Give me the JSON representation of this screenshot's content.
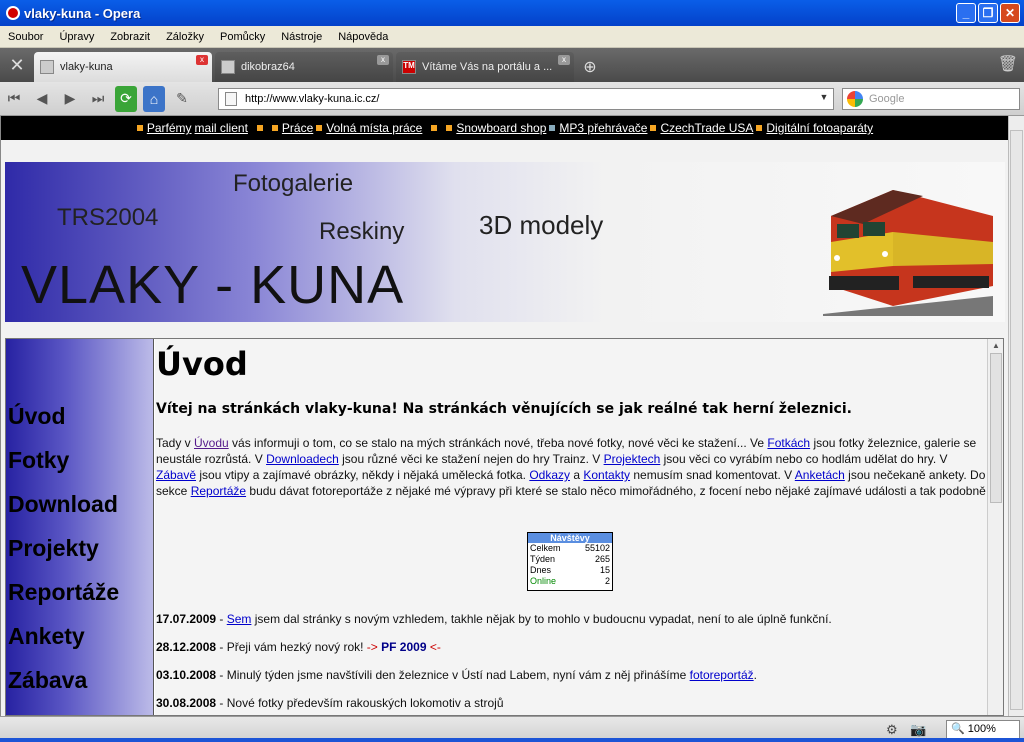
{
  "window": {
    "title": "vlaky-kuna - Opera"
  },
  "menu": [
    "Soubor",
    "Úpravy",
    "Zobrazit",
    "Záložky",
    "Pomůcky",
    "Nástroje",
    "Nápověda"
  ],
  "tabs": [
    {
      "label": "vlaky-kuna",
      "active": true
    },
    {
      "label": "dikobraz64",
      "active": false
    },
    {
      "label": "Vítáme Vás na portálu a ...",
      "active": false
    }
  ],
  "address": {
    "url": "http://www.vlaky-kuna.ic.cz/"
  },
  "search": {
    "placeholder": "Google"
  },
  "adbar": [
    "Parfémy",
    "mail client",
    "Práce",
    "Volná místa práce",
    "Snowboard shop",
    "MP3 přehrávače",
    "CzechTrade USA",
    "Digitální fotoaparáty"
  ],
  "banner": {
    "trs": "TRS2004",
    "foto": "Fotogalerie",
    "resk": "Reskiny",
    "modely": "3D modely",
    "title": "VLAKY - KUNA"
  },
  "leftnav": [
    "Úvod",
    "Fotky",
    "Download",
    "Projekty",
    "Reportáže",
    "Ankety",
    "Zábava"
  ],
  "content": {
    "heading": "Úvod",
    "welcome": "Vítej na stránkách vlaky-kuna! Na stránkách věnujících se jak reálné tak herní železnici.",
    "intro": {
      "t1": "Tady v ",
      "l1": "Úvodu",
      "t2": " vás informuji o tom, co se stalo na mých stránkách nové, třeba nové fotky, nové věci ke stažení... Ve ",
      "l2": "Fotkách",
      "t3": " jsou fotky železnice, galerie se neustále rozrůstá. V ",
      "l3": "Downloadech",
      "t4": " jsou různé věci ke stažení nejen do hry Trainz. V ",
      "l4": "Projektech",
      "t5": " jsou věci co vyrábím nebo co hodlám udělat do hry. V ",
      "l5": "Zábavě",
      "t6": " jsou vtipy a zajímavé obrázky, někdy i nějaká umělecká fotka. ",
      "l6": "Odkazy",
      "t7": " a ",
      "l7": "Kontakty",
      "t8": " nemusím snad komentovat. V ",
      "l8": "Anketách",
      "t9": " jsou nečekaně ankety. Do sekce ",
      "l9": "Reportáže",
      "t10": " budu dávat fotoreportáže z nějaké mé výpravy při které se stalo něco mimořádného, z focení nebo nějaké zajímavé události a tak podobně"
    },
    "counter": {
      "header": "Návštěvy",
      "rows": [
        {
          "label": "Celkem",
          "value": "55102"
        },
        {
          "label": "Týden",
          "value": "265"
        },
        {
          "label": "Dnes",
          "value": "15"
        },
        {
          "label": "Online",
          "value": "2"
        }
      ]
    },
    "news": [
      {
        "date": "17.07.2009",
        "sep": " - ",
        "link": "Sem",
        "text": " jsem dal stránky s novým vzhledem, takhle nějak by to mohlo v budoucnu vypadat, není to ale úplně funkční."
      },
      {
        "date": "28.12.2008",
        "sep": " - ",
        "text": "Přeji vám hezký nový rok! ",
        "pf1": "->",
        "pfb": " PF 2009 ",
        "pf2": "<-"
      },
      {
        "date": "03.10.2008",
        "sep": " - ",
        "text": "Minulý týden jsme navštívili den železnice v Ústí nad Labem, nyní vám z něj přinášíme ",
        "link": "fotoreportáž",
        "tail": "."
      },
      {
        "date": "30.08.2008",
        "sep": " - ",
        "text": "Nové fotky především rakouských lokomotiv a strojů"
      }
    ]
  },
  "status": {
    "zoom": "100%"
  },
  "colors": {
    "titlebar": "#0a5ee8",
    "link": "#0000cc",
    "adbar": "#000000",
    "navgradient": "#2722a2"
  }
}
